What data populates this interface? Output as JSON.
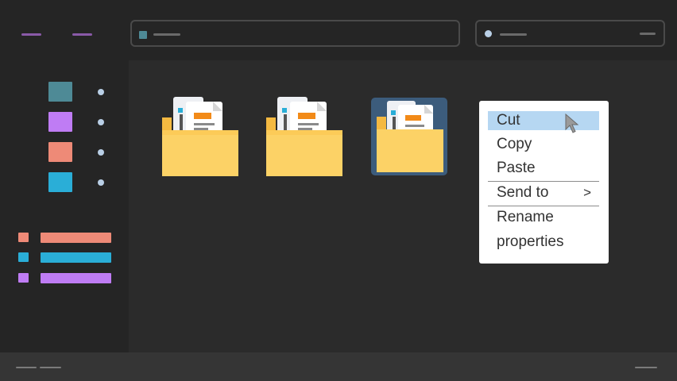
{
  "context_menu": {
    "items": [
      {
        "label": "Cut"
      },
      {
        "label": "Copy"
      },
      {
        "label": "Paste"
      },
      {
        "label": "Send to",
        "submenu_arrow": ">"
      },
      {
        "label": "Rename"
      },
      {
        "label": "properties"
      }
    ],
    "highlighted": "Cut"
  },
  "sidebar": {
    "swatches": [
      "#4e8a96",
      "#bf7cf4",
      "#ee8a77",
      "#2aaed7"
    ],
    "list_colors": [
      "#ee8a77",
      "#2aaed7",
      "#bf7cf4"
    ]
  },
  "folders": [
    {
      "selected": false,
      "icon": "folder-with-documents-icon"
    },
    {
      "selected": false,
      "icon": "folder-with-documents-icon"
    },
    {
      "selected": true,
      "icon": "folder-with-documents-icon"
    }
  ],
  "colors": {
    "selection": "#3c5c7c",
    "menu_highlight": "#b6d7f2",
    "folder": "#fcd266"
  }
}
